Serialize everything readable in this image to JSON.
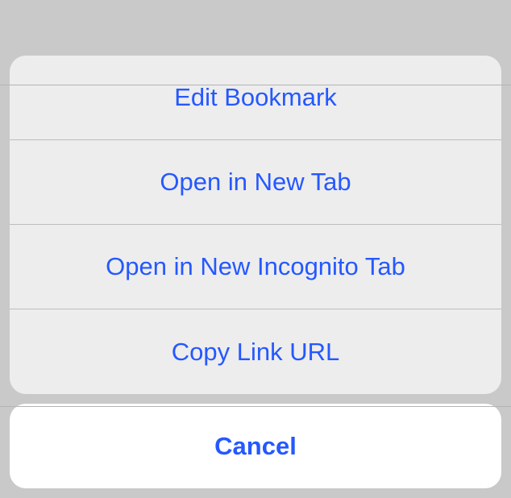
{
  "actions": [
    {
      "label": "Edit Bookmark"
    },
    {
      "label": "Open in New Tab"
    },
    {
      "label": "Open in New Incognito Tab"
    },
    {
      "label": "Copy Link URL"
    }
  ],
  "cancel": {
    "label": "Cancel"
  }
}
